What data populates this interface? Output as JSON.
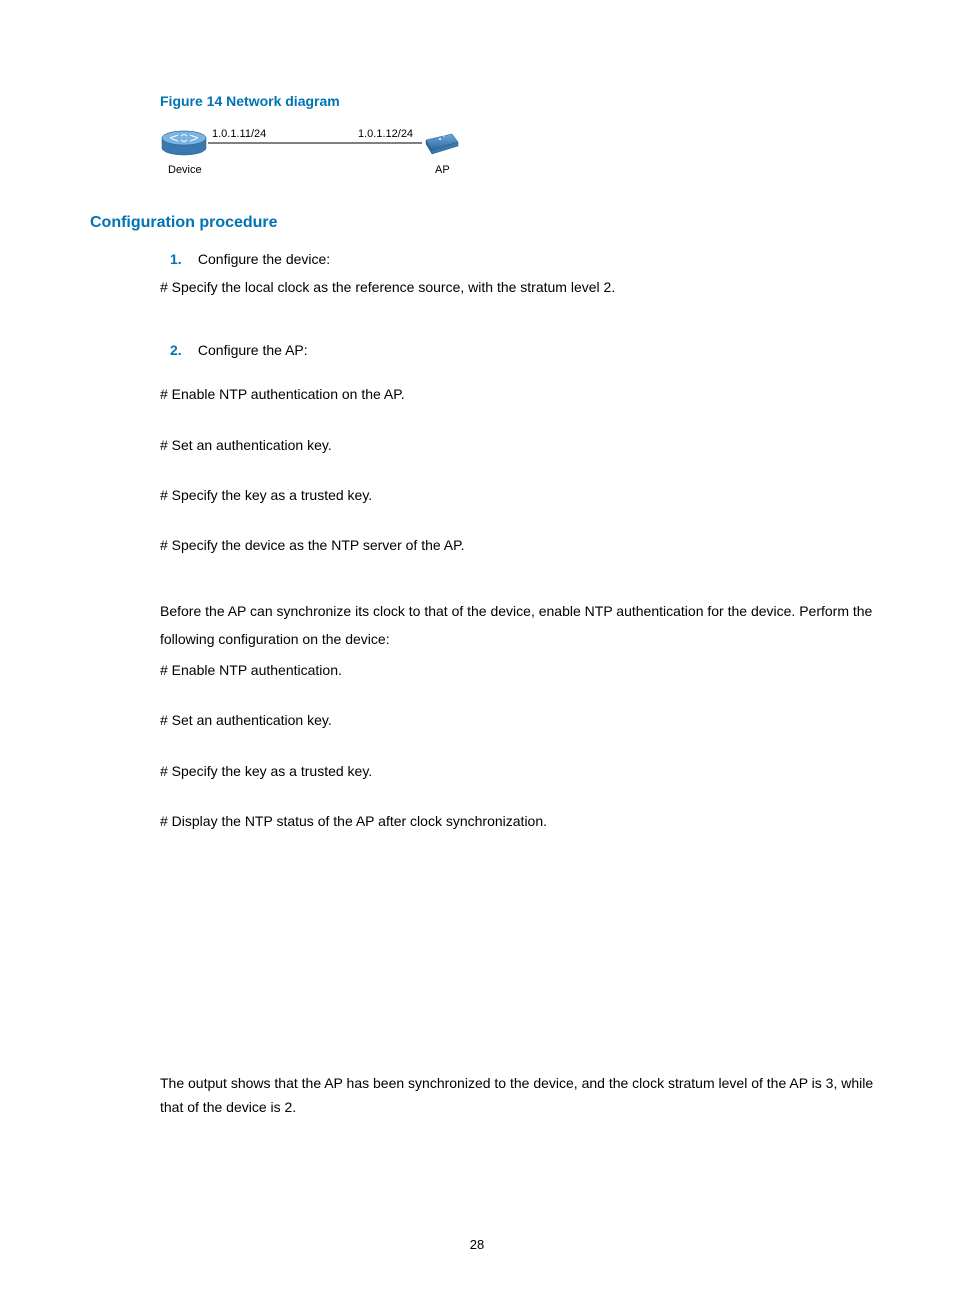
{
  "figure": {
    "title": "Figure 14 Network diagram",
    "device_ip": "1.0.1.11/24",
    "ap_ip": "1.0.1.12/24",
    "device_label": "Device",
    "ap_label": "AP"
  },
  "section_heading": "Configuration procedure",
  "steps": {
    "s1_num": "1.",
    "s1_text": "Configure the device:",
    "s1_detail": "# Specify the local clock as the reference source, with the stratum level 2.",
    "s2_num": "2.",
    "s2_text": "Configure the AP:"
  },
  "lines": {
    "l1": "# Enable NTP authentication on the AP.",
    "l2": "# Set an authentication key.",
    "l3": "# Specify the key as a trusted key.",
    "l4": "# Specify the device as the NTP server of the AP.",
    "p1": "Before the AP can synchronize its clock to that of the device, enable NTP authentication for the device. Perform the following configuration on the device:",
    "l5": "# Enable NTP authentication.",
    "l6": "# Set an authentication key.",
    "l7": "# Specify the key as a trusted key.",
    "l8": "# Display the NTP status of the AP after clock synchronization.",
    "p2": "The output shows that the AP has been synchronized to the device, and the clock stratum level of the AP is 3, while that of the device is 2."
  },
  "page_number": "28"
}
